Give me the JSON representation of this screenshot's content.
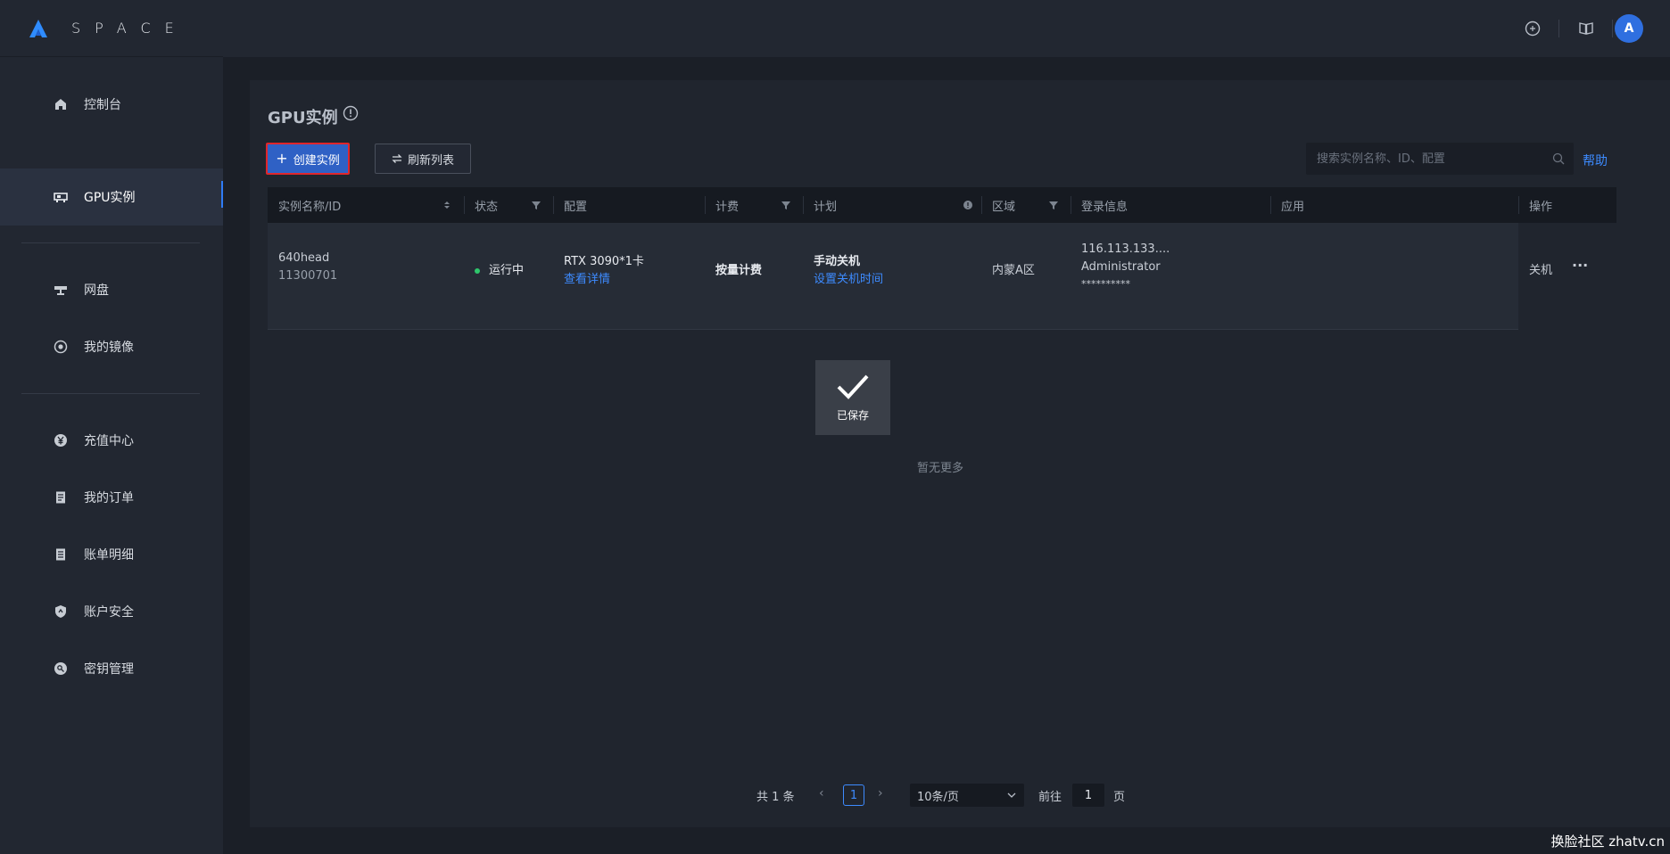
{
  "app": {
    "logo_text": "SPACE"
  },
  "sidebar": {
    "items": [
      {
        "label": "控制台",
        "icon": "home-icon"
      },
      {
        "label": "GPU实例",
        "icon": "gpu-icon",
        "active": true
      },
      {
        "label": "网盘",
        "icon": "disk-icon"
      },
      {
        "label": "我的镜像",
        "icon": "image-icon"
      },
      {
        "label": "充值中心",
        "icon": "yen-icon"
      },
      {
        "label": "我的订单",
        "icon": "order-icon"
      },
      {
        "label": "账单明细",
        "icon": "bill-icon"
      },
      {
        "label": "账户安全",
        "icon": "shield-icon"
      },
      {
        "label": "密钥管理",
        "icon": "key-icon"
      }
    ]
  },
  "topbar": {
    "avatar_letter": "A"
  },
  "page": {
    "title": "GPU实例",
    "create_button": "创建实例",
    "refresh_button": "刷新列表",
    "search_placeholder": "搜索实例名称、ID、配置",
    "help_link": "帮助"
  },
  "table": {
    "columns": [
      "实例名称/ID",
      "状态",
      "配置",
      "计费",
      "计划",
      "区域",
      "登录信息",
      "应用",
      "操作"
    ],
    "rows": [
      {
        "name": "640head",
        "id": "11300701",
        "status": "运行中",
        "config": "RTX 3090*1卡",
        "config_link": "查看详情",
        "billing": "按量计费",
        "plan": "手动关机",
        "plan_link": "设置关机时间",
        "region": "内蒙A区",
        "login_ip": "116.113.133....",
        "login_user": "Administrator",
        "login_pass": "**********",
        "action": "关机"
      }
    ],
    "empty_text": "暂无更多"
  },
  "toast": {
    "text": "已保存"
  },
  "pagination": {
    "total_text": "共 1 条",
    "current_page": "1",
    "page_size": "10条/页",
    "goto_label": "前往",
    "goto_value": "1",
    "goto_suffix": "页"
  },
  "watermark": "换脸社区 zhatv.cn",
  "colors": {
    "accent": "#2f61c5",
    "link": "#3d8bff",
    "running": "#2ec76b",
    "highlight_border": "#e0262b"
  }
}
